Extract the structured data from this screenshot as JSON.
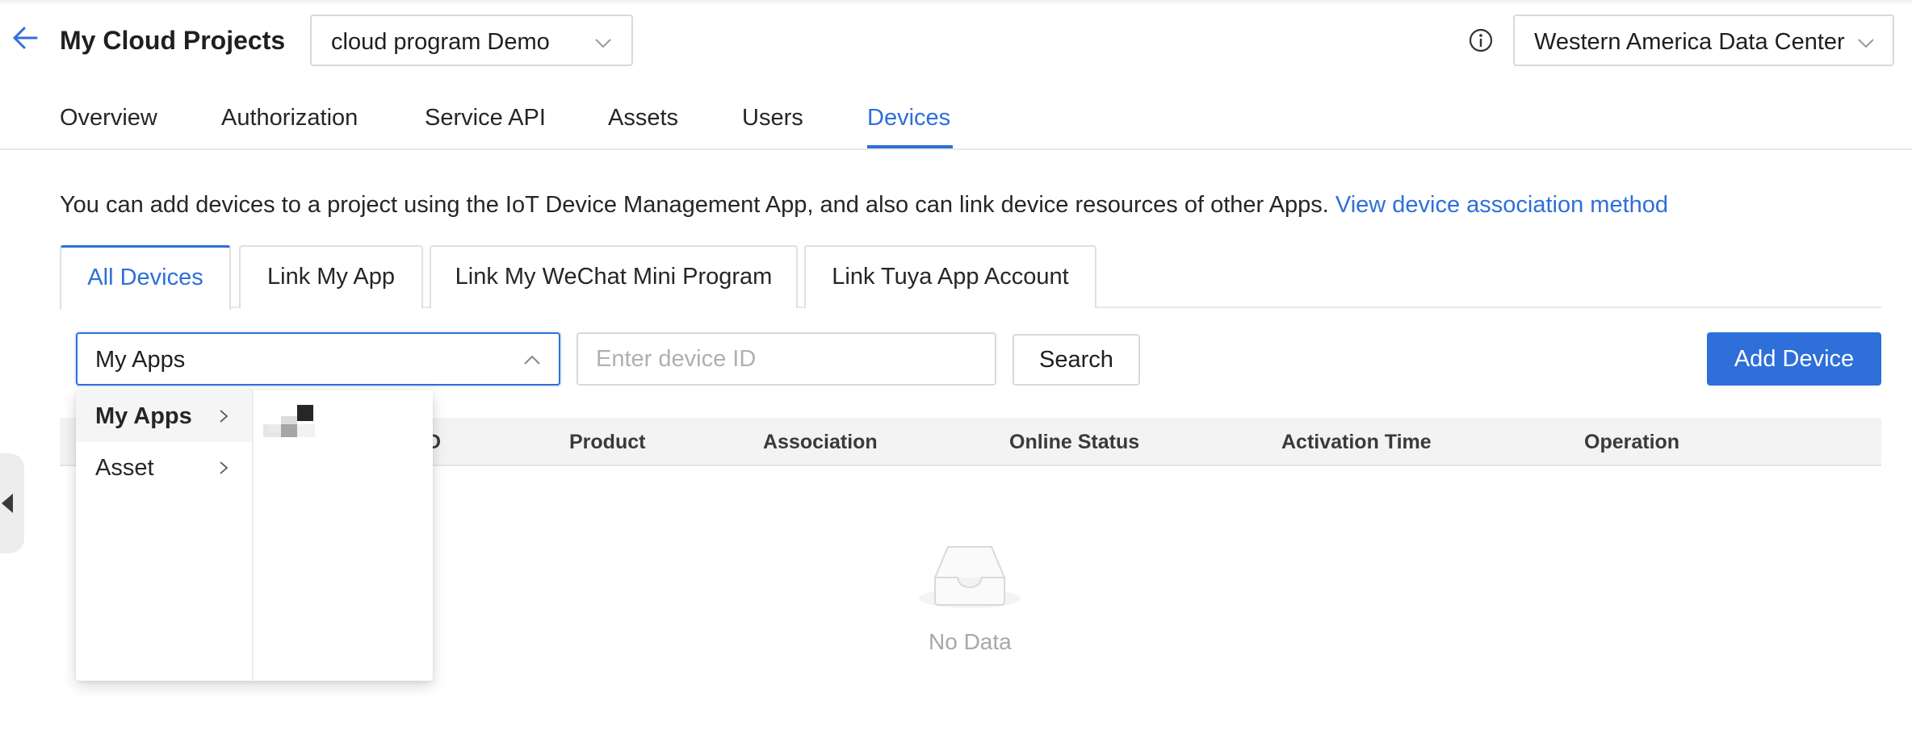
{
  "header": {
    "title": "My Cloud Projects",
    "project_select": "cloud program Demo",
    "data_center": "Western America Data Center"
  },
  "main_tabs": [
    {
      "label": "Overview"
    },
    {
      "label": "Authorization"
    },
    {
      "label": "Service API"
    },
    {
      "label": "Assets"
    },
    {
      "label": "Users"
    },
    {
      "label": "Devices",
      "active": true
    }
  ],
  "info": {
    "text": "You can add devices to a project using the IoT Device Management App, and also can link device resources of other Apps.",
    "link": "View device association method"
  },
  "sub_tabs": [
    {
      "label": "All Devices",
      "active": true
    },
    {
      "label": "Link My App"
    },
    {
      "label": "Link My WeChat Mini Program"
    },
    {
      "label": "Link Tuya App Account"
    }
  ],
  "filters": {
    "cascader_value": "My Apps",
    "device_id_placeholder": "Enter device ID",
    "search_label": "Search",
    "add_device_label": "Add Device"
  },
  "table": {
    "columns": [
      "D",
      "Product",
      "Association",
      "Online Status",
      "Activation Time",
      "Operation"
    ],
    "empty_text": "No Data"
  },
  "dropdown": {
    "options": [
      {
        "label": "My Apps",
        "active": true
      },
      {
        "label": "Asset"
      }
    ]
  },
  "colors": {
    "accent": "#2e6fd9",
    "text": "#1f1f1f",
    "muted": "#a8a8a8",
    "border": "#d9d9d9"
  },
  "icons": {
    "back": "arrow-left-icon",
    "info": "info-circle-icon",
    "chevron": "chevron-down-icon",
    "empty": "empty-inbox-icon"
  }
}
